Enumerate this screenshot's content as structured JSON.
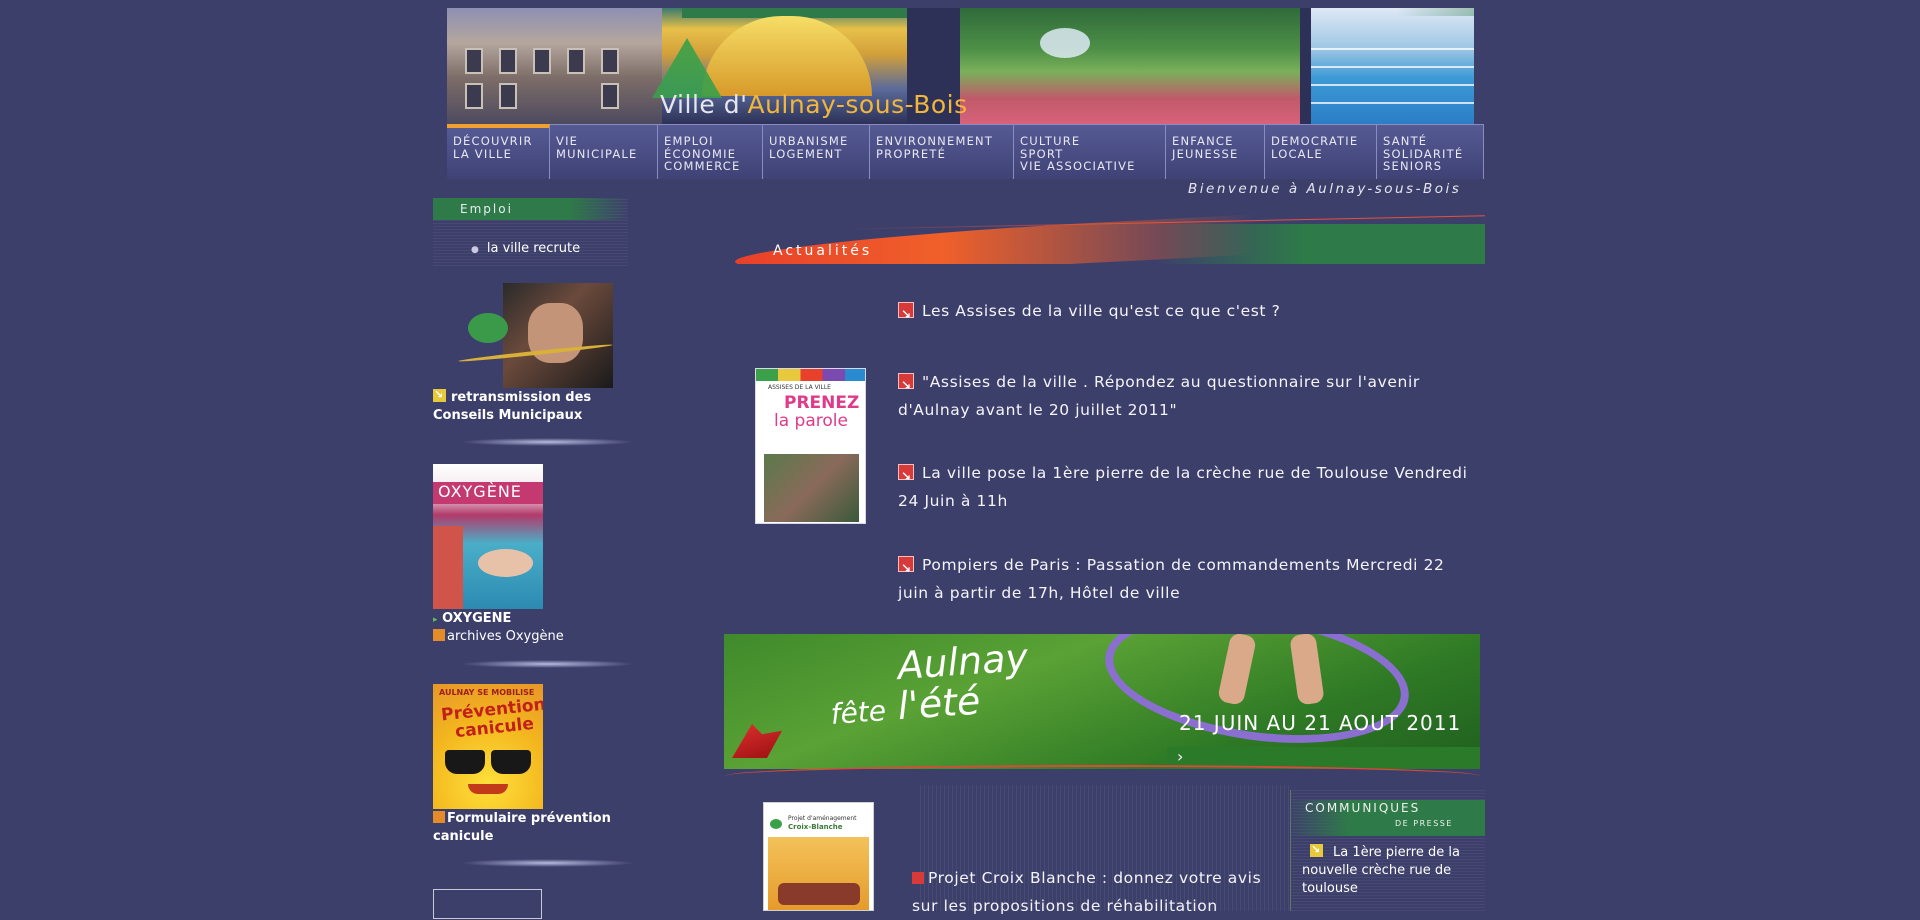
{
  "header": {
    "title_prefix": "Ville d'",
    "title_city": "Aulnay-sous-Bois",
    "welcome": "Bienvenue à Aulnay-sous-Bois"
  },
  "nav": [
    {
      "label": "Découvrir\nla ville",
      "active": true
    },
    {
      "label": "Vie\nmunicipale"
    },
    {
      "label": "Emploi\nÉconomie\nCommerce"
    },
    {
      "label": "Urbanisme\nLogement"
    },
    {
      "label": "Environnement\nPropreté"
    },
    {
      "label": "Culture\nSport\nVie associative"
    },
    {
      "label": "Enfance\nJeunesse"
    },
    {
      "label": "Democratie\nlocale"
    },
    {
      "label": "Santé\nSolidarité\nSeniors"
    }
  ],
  "sidebar": {
    "emploi": {
      "title": "Emploi",
      "link": "la ville recrute"
    },
    "conseils": {
      "link": "retransmission des Conseils Municipaux"
    },
    "oxygene": {
      "cover_title": "OXYGÈNE",
      "link1": "OXYGENE",
      "link2": "archives Oxygène"
    },
    "canicule": {
      "poster_top": "AULNAY SE MOBILISE",
      "poster_line1": "Prévention",
      "poster_line2": "canicule",
      "link": "Formulaire prévention canicule"
    }
  },
  "main": {
    "actualites_title": "Actualités",
    "news": [
      "Les Assises de la ville qu'est ce que c'est ?",
      "\"Assises de la ville . Répondez au questionnaire sur l'avenir d'Aulnay avant le 20 juillet 2011\"",
      "La ville pose la 1ère pierre de la crèche rue de Toulouse Vendredi 24 Juin à 11h",
      "Pompiers de Paris : Passation de commandements Mercredi 22 juin à partir de 17h, Hôtel de ville"
    ],
    "poster_prenez": {
      "top": "ASSISES DE LA VILLE",
      "line1": "PRENEZ",
      "line2": "la parole"
    },
    "banner": {
      "line1": "Aulnay",
      "line2a": "fête",
      "line2b": "l'été",
      "dates": "21 JUIN AU 21 AOUT 2011"
    },
    "croix_poster": {
      "title_line1": "Projet d'aménagement",
      "title_line2": "Croix-Blanche"
    },
    "croix_news": "Projet Croix Blanche : donnez votre avis sur les propositions de réhabilitation"
  },
  "communiques": {
    "title": "Communiques",
    "subtitle": "de presse",
    "item": "La 1ère pierre de la nouvelle crèche rue de toulouse"
  }
}
